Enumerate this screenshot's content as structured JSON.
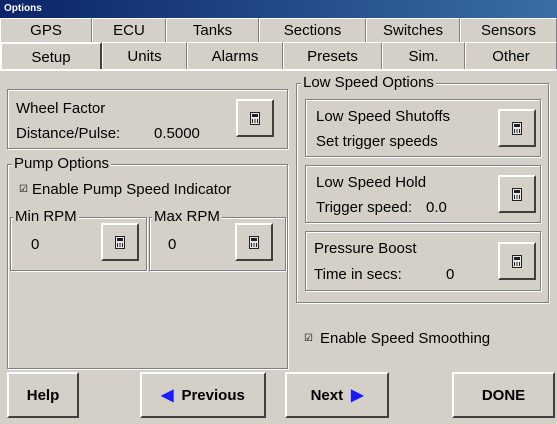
{
  "window": {
    "title": "Options"
  },
  "tabs_row1": [
    "GPS",
    "ECU",
    "Tanks",
    "Sections",
    "Switches",
    "Sensors"
  ],
  "tabs_row2": [
    "Setup",
    "Units",
    "Alarms",
    "Presets",
    "Sim.",
    "Other"
  ],
  "active_tab": "Setup",
  "wheel": {
    "title": "Wheel Factor",
    "label": "Distance/Pulse:",
    "value": "0.5000",
    "icon": "calculator-icon"
  },
  "pump": {
    "group_label": "Pump Options",
    "checkbox_mark": "☑",
    "checkbox_label": "Enable Pump Speed Indicator",
    "min_label": "Min RPM",
    "min_value": "0",
    "max_label": "Max RPM",
    "max_value": "0"
  },
  "low_speed": {
    "group_label": "Low Speed Options",
    "shutoffs_title": "Low Speed Shutoffs",
    "shutoffs_sub": "Set trigger speeds",
    "hold_title": "Low Speed Hold",
    "hold_label": "Trigger speed:",
    "hold_value": "0.0",
    "boost_title": "Pressure Boost",
    "boost_label": "Time in secs:",
    "boost_value": "0"
  },
  "smoothing": {
    "checkbox_mark": "☑",
    "label": "Enable Speed Smoothing"
  },
  "buttons": {
    "help": "Help",
    "previous": "Previous",
    "previous_arrow": "◀",
    "next": "Next",
    "next_arrow": "▶",
    "done": "DONE"
  }
}
